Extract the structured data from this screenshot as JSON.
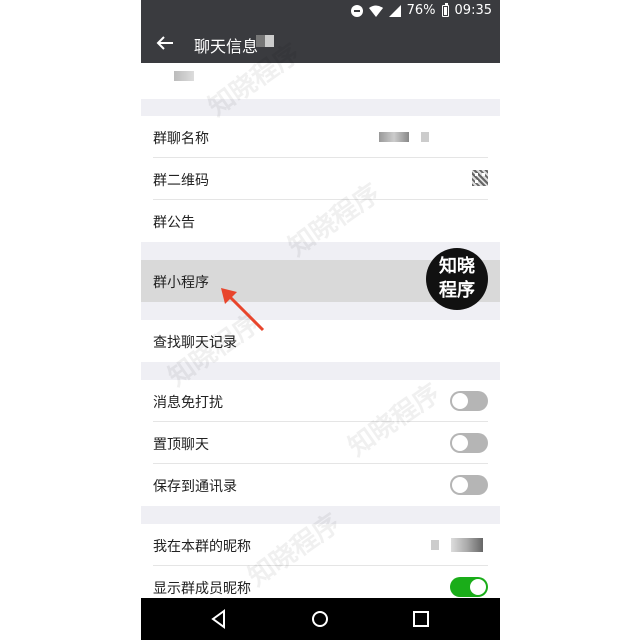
{
  "status_bar": {
    "battery": "76%",
    "time": "09:35"
  },
  "header": {
    "title": "聊天信息"
  },
  "rows": {
    "group_name": "群聊名称",
    "group_qr": "群二维码",
    "group_notice": "群公告",
    "group_miniprogram": "群小程序",
    "search_history": "查找聊天记录",
    "mute": "消息免打扰",
    "sticky": "置顶聊天",
    "save_contacts": "保存到通讯录",
    "my_nickname": "我在本群的昵称",
    "show_nicknames": "显示群成员昵称"
  },
  "toggles": {
    "mute": false,
    "sticky": false,
    "save_contacts": false,
    "show_nicknames": true
  },
  "badge": {
    "line1": "知晓",
    "line2": "程序"
  },
  "watermark": "知晓程序",
  "colors": {
    "titlebar": "#3a3b3f",
    "toggle_on": "#1aad19",
    "arrow": "#e8452c"
  },
  "icons": {
    "back": "arrow-left-icon",
    "qr": "qr-code-icon",
    "nav_back": "triangle-back-icon",
    "nav_home": "circle-home-icon",
    "nav_recent": "square-recent-icon"
  }
}
